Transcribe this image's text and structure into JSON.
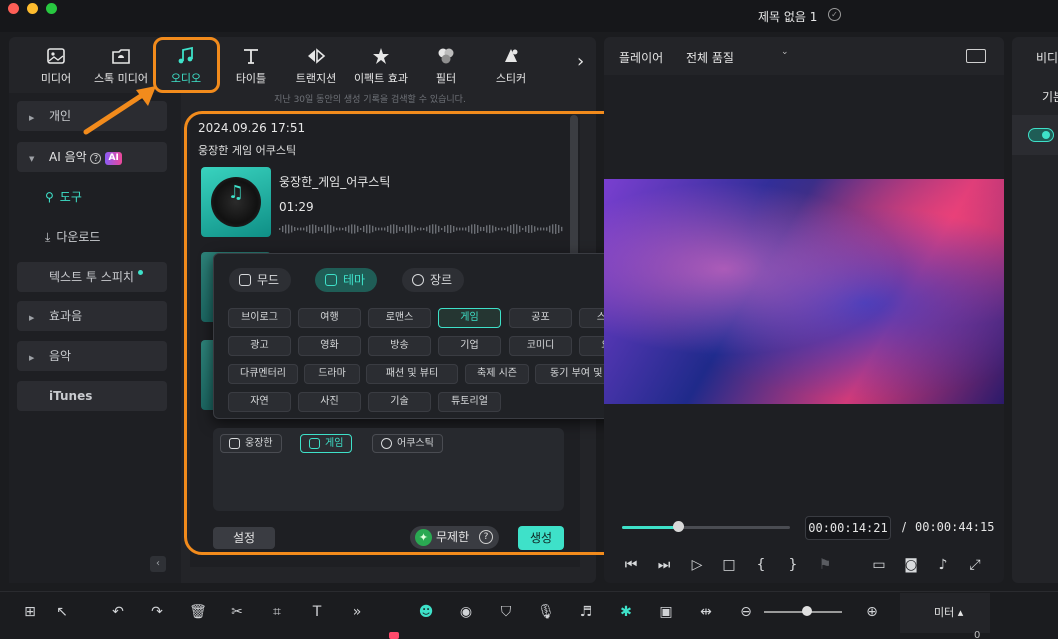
{
  "project": {
    "title": "제목 없음 1"
  },
  "toolbar": {
    "items": [
      {
        "label": "미디어",
        "icon": "media-icon"
      },
      {
        "label": "스톡 미디어",
        "icon": "stock-media-icon"
      },
      {
        "label": "오디오",
        "icon": "music-note-icon",
        "active": true
      },
      {
        "label": "타이틀",
        "icon": "text-icon"
      },
      {
        "label": "트랜지션",
        "icon": "transition-icon"
      },
      {
        "label": "이펙트 효과",
        "icon": "effects-icon"
      },
      {
        "label": "필터",
        "icon": "filter-icon"
      },
      {
        "label": "스티커",
        "icon": "sticker-icon"
      }
    ],
    "more": "›"
  },
  "hint": "지난 30일 동안의 생성 기록을 검색할 수 있습니다.",
  "sidebar": {
    "personal": "개인",
    "ai_music": "AI 음악",
    "ai_badge": "AI",
    "tools": "도구",
    "download": "다운로드",
    "tts": "텍스트 투 스피치",
    "sound_effects": "효과음",
    "music": "음악",
    "itunes": "iTunes",
    "collapse": "‹"
  },
  "generation": {
    "date": "2024.09.26 17:51",
    "title": "웅장한 게임 어쿠스틱",
    "track_name": "웅장한_게임_어쿠스틱",
    "duration": "01:29"
  },
  "popup": {
    "tabs": [
      "무드",
      "테마",
      "장르"
    ],
    "active_tab": "테마",
    "tags": [
      [
        "브이로그",
        "여행",
        "로맨스",
        "게임",
        "공포",
        "스포츠"
      ],
      [
        "광고",
        "영화",
        "방송",
        "기업",
        "코미디",
        "요리"
      ],
      [
        "다큐멘터리",
        "드라마",
        "패션 및 뷰티",
        "축제 시즌",
        "동기 부여 및 영감"
      ],
      [
        "자연",
        "사진",
        "기술",
        "튜토리얼"
      ]
    ],
    "selected_tag": "게임"
  },
  "prompt": {
    "chips": [
      "웅장한",
      "게임",
      "어쿠스틱"
    ]
  },
  "actions": {
    "settings": "설정",
    "unlimited": "무제한",
    "generate": "생성"
  },
  "player": {
    "label": "플레이어",
    "quality": "전체 품질",
    "current_time": "00:00:14:21",
    "separator": "/",
    "total_time": "00:00:44:15",
    "progress": 0.33
  },
  "right_panel": {
    "label": "비디",
    "sub": "기본"
  },
  "bottom": {
    "meter": "미터 ▴",
    "zero": "0"
  },
  "colors": {
    "accent": "#3ee1c9",
    "annotation": "#f28b1c"
  }
}
